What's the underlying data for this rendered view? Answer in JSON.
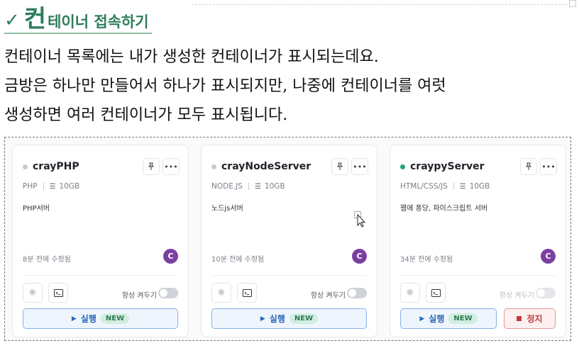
{
  "heading": {
    "check": "✓",
    "big": "컨",
    "rest": "테이너 접속하기"
  },
  "paragraph": [
    "컨테이너 목록에는 내가 생성한 컨테이너가 표시되는데요.",
    "금방은 하나만 만들어서 하나가 표시되지만, 나중에 컨테이너를 여럿",
    "생성하면 여러 컨테이너가 모두 표시됩니다."
  ],
  "cards": [
    {
      "name": "crayPHP",
      "stack": "PHP",
      "size": "10GB",
      "desc": "PHP서버",
      "edited": "8분 전에 수정됨",
      "avatar": "C",
      "always_on": "항상 켜두기",
      "run": "실행",
      "badge": "NEW",
      "running": false
    },
    {
      "name": "crayNodeServer",
      "stack": "NODE.JS",
      "size": "10GB",
      "desc": "노드js서버",
      "edited": "10분 전에 수정됨",
      "avatar": "C",
      "always_on": "항상 켜두기",
      "run": "실행",
      "badge": "NEW",
      "running": false
    },
    {
      "name": "craypyServer",
      "stack": "HTML/CSS/JS",
      "size": "10GB",
      "desc": "웹에 퐁당, 파이스크립트 서버",
      "edited": "34분 전에 수정됨",
      "avatar": "C",
      "always_on": "항상 켜두기",
      "run": "실행",
      "badge": "NEW",
      "stop": "정지",
      "running": true
    }
  ],
  "icons": {
    "pin": "pin-icon",
    "more": "more-icon",
    "disk": "disk-icon",
    "settings": "settings-icon",
    "terminal": "terminal-icon",
    "play": "play-icon",
    "stop": "stop-icon"
  },
  "colors": {
    "heading": "#2e7d5b",
    "avatar": "#7b3fa0",
    "running_dot": "#1fa67a",
    "run_button": "#2a66b8",
    "stop_button": "#c23a3a"
  }
}
